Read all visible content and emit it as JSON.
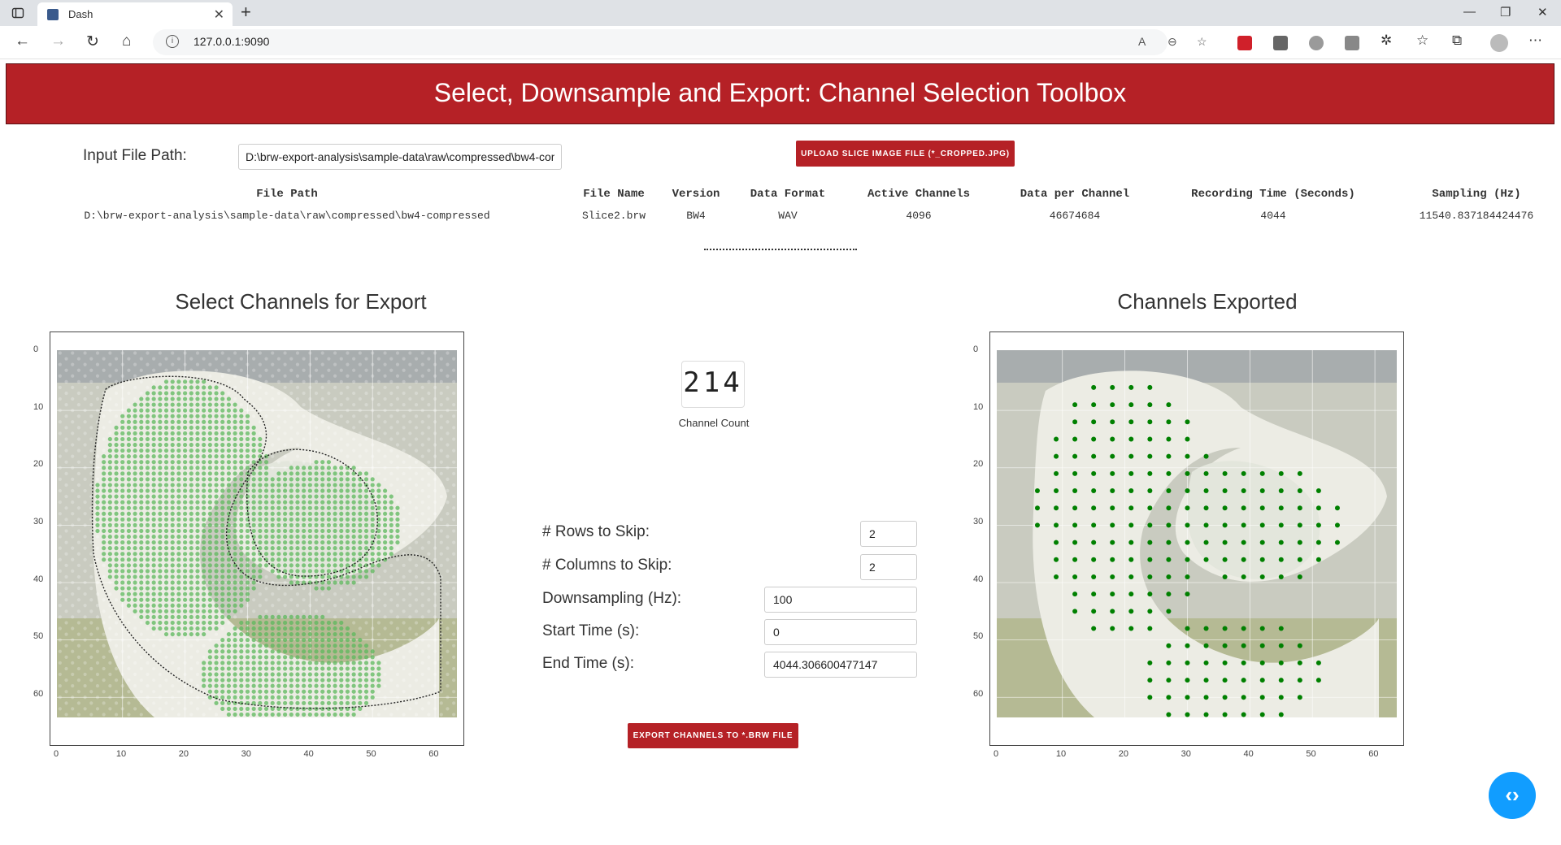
{
  "browser": {
    "tab_title": "Dash",
    "url": "127.0.0.1:9090"
  },
  "header": {
    "title": "Select, Downsample and Export: Channel Selection Toolbox",
    "color": "#b52126"
  },
  "input": {
    "label": "Input File Path:",
    "value": "D:\\brw-export-analysis\\sample-data\\raw\\compressed\\bw4-compressed"
  },
  "upload_button": "Upload Slice Image File (*_cropped.jpg)",
  "info_table": {
    "headers": [
      "File Path",
      "File Name",
      "Version",
      "Data Format",
      "Active Channels",
      "Data per Channel",
      "Recording Time (Seconds)",
      "Sampling (Hz)"
    ],
    "values": [
      "D:\\brw-export-analysis\\sample-data\\raw\\compressed\\bw4-compressed",
      "Slice2.brw",
      "BW4",
      "WAV",
      "4096",
      "46674684",
      "4044",
      "11540.837184424476"
    ]
  },
  "left_plot": {
    "title": "Select Channels for Export",
    "x_ticks": [
      "0",
      "10",
      "20",
      "30",
      "40",
      "50",
      "60"
    ],
    "y_ticks": [
      "0",
      "10",
      "20",
      "30",
      "40",
      "50",
      "60"
    ]
  },
  "right_plot": {
    "title": "Channels Exported",
    "x_ticks": [
      "0",
      "10",
      "20",
      "30",
      "40",
      "50",
      "60"
    ],
    "y_ticks": [
      "0",
      "10",
      "20",
      "30",
      "40",
      "50",
      "60"
    ]
  },
  "channel_count": {
    "value": "214",
    "label": "Channel Count"
  },
  "form": {
    "rows_label": "# Rows to Skip:",
    "rows_value": "2",
    "cols_label": "# Columns to Skip:",
    "cols_value": "2",
    "downsampling_label": "Downsampling (Hz):",
    "downsampling_value": "100",
    "start_label": "Start Time (s):",
    "start_value": "0",
    "end_label": "End Time (s):",
    "end_value": "4044.306600477147"
  },
  "export_button": "Export Channels to *.brw File",
  "colors": {
    "selected_dot": "#5cb85c",
    "exported_dot": "#008000",
    "fab": "#119dff"
  }
}
